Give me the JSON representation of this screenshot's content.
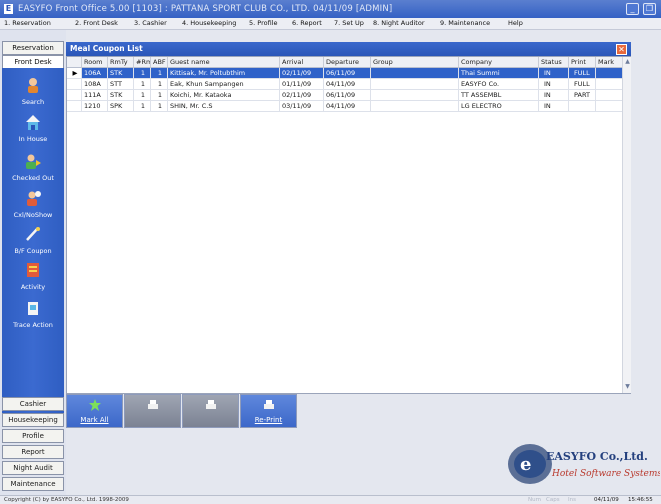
{
  "window": {
    "title": "EASYFO Front Office 5.00 [1103] : PATTANA SPORT CLUB CO., LTD. 04/11/09 [ADMIN]",
    "min_label": "_",
    "max_label": "❐"
  },
  "menu": [
    "1. Reservation",
    "2. Front Desk",
    "3. Cashier",
    "4. Housekeeping",
    "5. Profile",
    "6. Report",
    "7. Set Up",
    "8. Night Auditor",
    "9. Maintenance",
    "Help"
  ],
  "leftnav": {
    "tabs": [
      "Reservation",
      "Front Desk"
    ],
    "items": [
      "Search",
      "In House",
      "Checked Out",
      "Cxl/NoShow",
      "B/F Coupon",
      "Activity",
      "Trace Action"
    ],
    "bottom": [
      "Cashier",
      "Housekeeping",
      "Profile",
      "Report",
      "Night Audit",
      "Maintenance"
    ]
  },
  "panel": {
    "title": "Meal Coupon List",
    "close_label": "✕"
  },
  "grid": {
    "columns": [
      "Room",
      "RmTy",
      "#Rm",
      "ABF",
      "Guest name",
      "Arrival",
      "Departure",
      "Group",
      "Company",
      "Status",
      "Print",
      "Mark"
    ],
    "rows": [
      {
        "indicator": "▶",
        "room": "106A",
        "rmty": "STK",
        "rm": "1",
        "abf": "1",
        "guest": "Kittisak, Mr. Poltubthim",
        "arrival": "02/11/09",
        "departure": "06/11/09",
        "group": "",
        "company": "Thai Summi",
        "status": "IN",
        "print": "FULL",
        "mark": ""
      },
      {
        "indicator": "",
        "room": "108A",
        "rmty": "STT",
        "rm": "1",
        "abf": "1",
        "guest": "Eak, Khun Sampangen",
        "arrival": "01/11/09",
        "departure": "04/11/09",
        "group": "",
        "company": "EASYFO Co.",
        "status": "IN",
        "print": "FULL",
        "mark": ""
      },
      {
        "indicator": "",
        "room": "111A",
        "rmty": "STK",
        "rm": "1",
        "abf": "1",
        "guest": "Koichi, Mr. Kataoka",
        "arrival": "02/11/09",
        "departure": "06/11/09",
        "group": "",
        "company": "TT ASSEMBL",
        "status": "IN",
        "print": "PART",
        "mark": ""
      },
      {
        "indicator": "",
        "room": "1210",
        "rmty": "SPK",
        "rm": "1",
        "abf": "1",
        "guest": "SHIN, Mr. C.S",
        "arrival": "03/11/09",
        "departure": "04/11/09",
        "group": "",
        "company": "LG ELECTRO",
        "status": "IN",
        "print": "",
        "mark": ""
      }
    ]
  },
  "toolbar": {
    "mark_all": "Mark All",
    "reprint": "Re-Print"
  },
  "logo": {
    "brand": "EASYFO Co.,Ltd.",
    "tagline": "Hotel Software Systems"
  },
  "status": {
    "copyright": "Copyright (C) by EASYFO Co., Ltd. 1998-2009",
    "ghost1": "Num",
    "ghost2": "Caps",
    "ghost3": "Ins",
    "date": "04/11/09",
    "time": "15:46:55"
  },
  "colors": {
    "accent": "#2f62c9",
    "titlebar": "#3561c4",
    "close": "#e8693c"
  }
}
